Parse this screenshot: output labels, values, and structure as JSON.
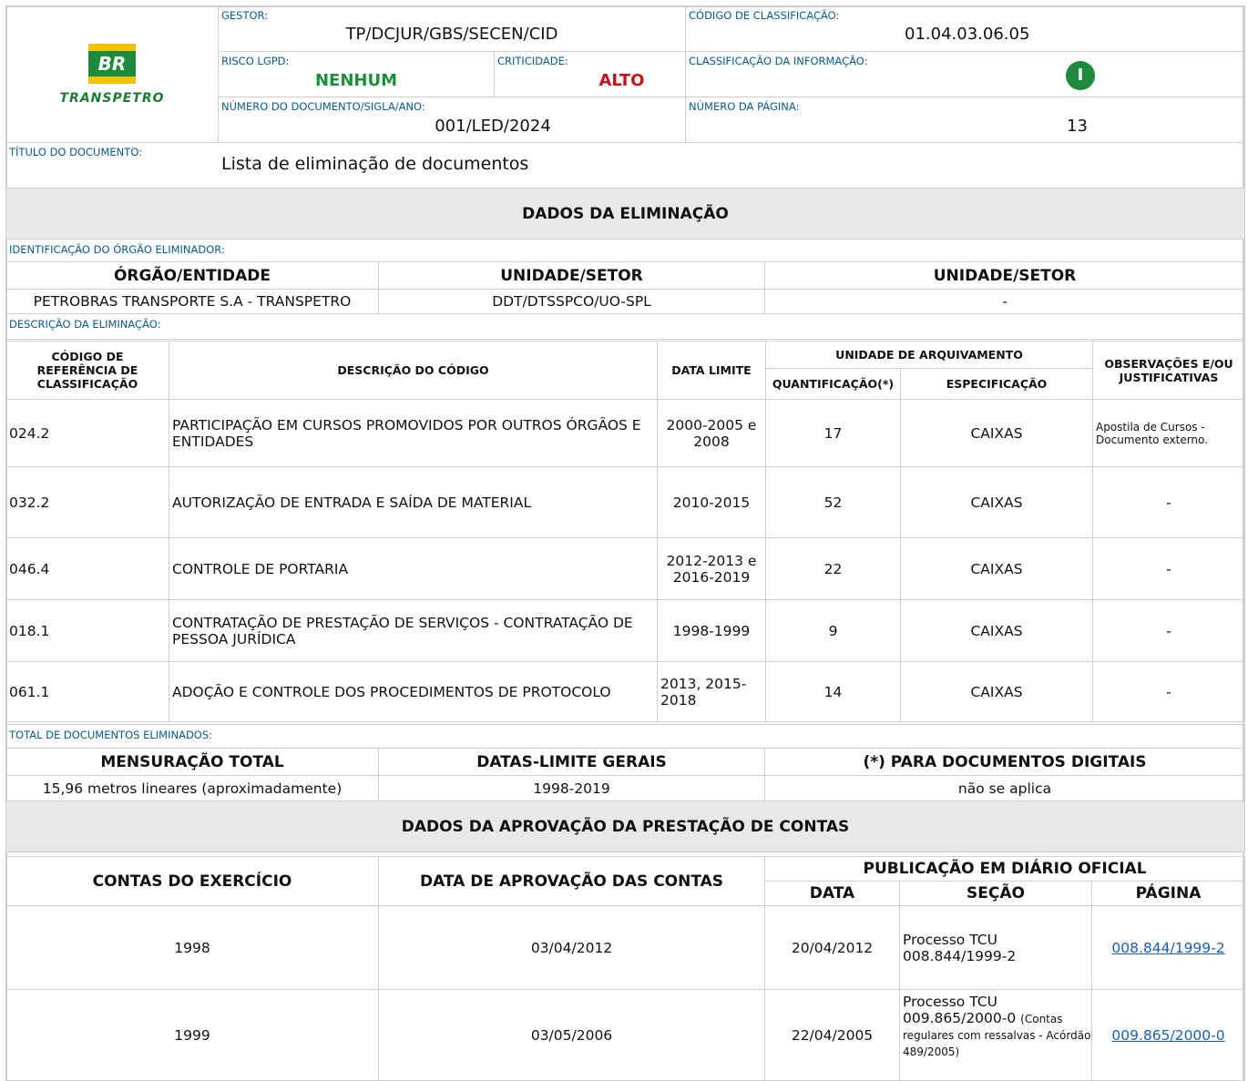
{
  "header": {
    "logo_br": "BR",
    "logo_name": "TRANSPETRO",
    "gestor_label": "GESTOR:",
    "gestor_value": "TP/DCJUR/GBS/SECEN/CID",
    "codigo_class_label": "CÓDIGO DE CLASSIFICAÇÃO:",
    "codigo_class_value": "01.04.03.06.05",
    "risco_label": "RISCO LGPD:",
    "risco_value": "NENHUM",
    "criticidade_label": "CRITICIDADE:",
    "criticidade_value": "ALTO",
    "class_info_label": "CLASSIFICAÇÃO DA INFORMAÇÃO:",
    "class_info_badge": "I",
    "numero_doc_label": "NÚMERO DO DOCUMENTO/SIGLA/ANO:",
    "numero_doc_value": "001/LED/2024",
    "numero_pag_label": "NÚMERO DA PÁGINA:",
    "numero_pag_value": "13",
    "titulo_label": "TÍTULO DO DOCUMENTO:",
    "titulo_value": "Lista de eliminação de documentos",
    "colors": {
      "label": "#0a5a8c",
      "green": "#1a8f3a",
      "red": "#c0141b",
      "badge": "#1e8a3c"
    }
  },
  "eliminacao": {
    "section_title": "DADOS DA ELIMINAÇÃO",
    "orgao_label": "IDENTIFICAÇÃO DO ÓRGÃO ELIMINADOR:",
    "orgao_headers": [
      "ÓRGÃO/ENTIDADE",
      "UNIDADE/SETOR",
      "UNIDADE/SETOR"
    ],
    "orgao_values": [
      "PETROBRAS TRANSPORTE S.A - TRANSPETRO",
      "DDT/DTSSPCO/UO-SPL",
      "-"
    ],
    "descricao_label": "DESCRIÇÃO DA ELIMINAÇÃO:",
    "headers": {
      "codigo": "CÓDIGO DE REFERÊNCIA DE CLASSIFICAÇÃO",
      "descricao": "DESCRIÇÃO DO CÓDIGO",
      "data_limite": "DATA LIMITE",
      "unidade": "UNIDADE DE ARQUIVAMENTO",
      "quantificacao": "QUANTIFICAÇÃO(*)",
      "especificacao": "ESPECIFICAÇÃO",
      "observacoes": "OBSERVAÇÕES E/OU JUSTIFICATIVAS"
    },
    "rows": [
      {
        "codigo": "024.2",
        "descricao": "PARTICIPAÇÃO EM CURSOS PROMOVIDOS POR OUTROS ÓRGÃOS E ENTIDADES",
        "data": "2000-2005 e 2008",
        "qtd": "17",
        "esp": "CAIXAS",
        "obs": "Apostila de Cursos - Documento externo."
      },
      {
        "codigo": "032.2",
        "descricao": "AUTORIZAÇÃO DE ENTRADA E SAÍDA DE MATERIAL",
        "data": "2010-2015",
        "qtd": "52",
        "esp": "CAIXAS",
        "obs": "-"
      },
      {
        "codigo": "046.4",
        "descricao": "CONTROLE DE PORTARIA",
        "data": "2012-2013 e 2016-2019",
        "qtd": "22",
        "esp": "CAIXAS",
        "obs": "-"
      },
      {
        "codigo": "018.1",
        "descricao": "CONTRATAÇÃO DE PRESTAÇÃO DE SERVIÇOS - CONTRATAÇÃO DE PESSOA JURÍDICA",
        "data": "1998-1999",
        "qtd": "9",
        "esp": "CAIXAS",
        "obs": "-"
      },
      {
        "codigo": "061.1",
        "descricao": "ADOÇÃO E CONTROLE DOS PROCEDIMENTOS DE PROTOCOLO",
        "data": "2013, 2015-2018",
        "qtd": "14",
        "esp": "CAIXAS",
        "obs": "-"
      }
    ],
    "total_label": "TOTAL DE DOCUMENTOS ELIMINADOS:",
    "total_headers": [
      "MENSURAÇÃO TOTAL",
      "DATAS-LIMITE GERAIS",
      "(*) PARA DOCUMENTOS DIGITAIS"
    ],
    "total_values": [
      "15,96 metros lineares (aproximadamente)",
      "1998-2019",
      "não se aplica"
    ]
  },
  "aprovacao": {
    "section_title": "DADOS DA APROVAÇÃO DA PRESTAÇÃO DE CONTAS",
    "headers": {
      "contas": "CONTAS DO EXERCÍCIO",
      "data_aprov": "DATA DE APROVAÇÃO DAS CONTAS",
      "publicacao": "PUBLICAÇÃO EM DIÁRIO OFICIAL",
      "data": "DATA",
      "secao": "SEÇÃO",
      "pagina": "PÁGINA"
    },
    "rows": [
      {
        "contas": "1998",
        "data_aprov": "03/04/2012",
        "data": "20/04/2012",
        "secao_main": "Processo TCU 008.844/1999-2",
        "secao_note": "",
        "pagina": "008.844/1999-2"
      },
      {
        "contas": "1999",
        "data_aprov": "03/05/2006",
        "data": "22/04/2005",
        "secao_main": "Processo TCU 009.865/2000-0",
        "secao_note": "(Contas regulares com ressalvas - Acórdão 489/2005)",
        "pagina": "009.865/2000-0"
      }
    ]
  }
}
